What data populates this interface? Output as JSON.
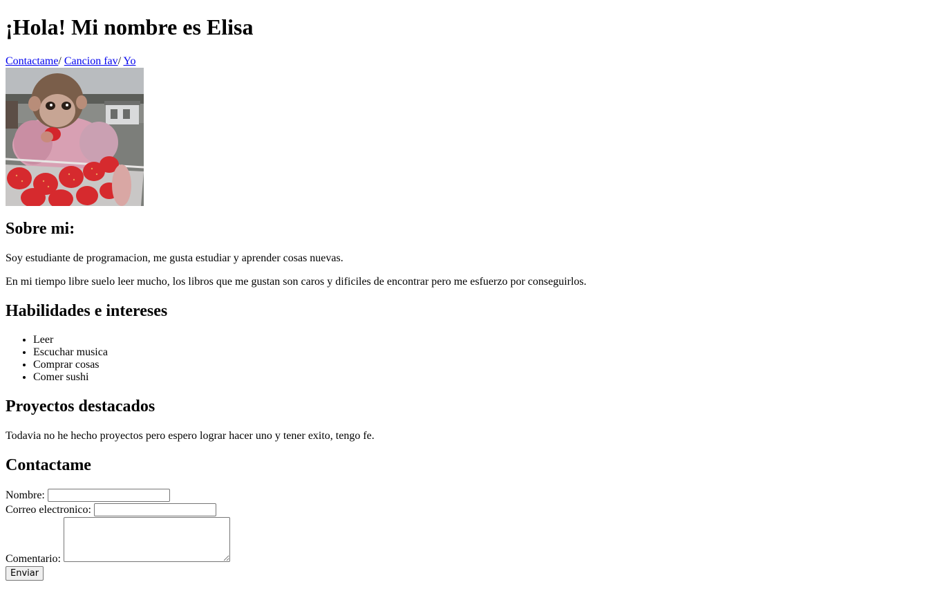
{
  "header": {
    "title": "¡Hola! Mi nombre es Elisa"
  },
  "nav": {
    "links": [
      {
        "label": "Contactame",
        "separator": "/ "
      },
      {
        "label": "Cancion fav",
        "separator": "/ "
      },
      {
        "label": "Yo",
        "separator": ""
      }
    ]
  },
  "about": {
    "heading": "Sobre mi:",
    "paragraphs": [
      "Soy estudiante de programacion, me gusta estudiar y aprender cosas nuevas.",
      "En mi tiempo libre suelo leer mucho, los libros que me gustan son caros y dificiles de encontrar pero me esfuerzo por conseguirlos."
    ]
  },
  "skills": {
    "heading": "Habilidades e intereses",
    "items": [
      "Leer",
      "Escuchar musica",
      "Comprar cosas",
      "Comer sushi"
    ]
  },
  "projects": {
    "heading": "Proyectos destacados",
    "text": "Todavia no he hecho proyectos pero espero lograr hacer uno y tener exito, tengo fe."
  },
  "contact": {
    "heading": "Contactame",
    "name_label": "Nombre:",
    "name_value": "",
    "email_label": "Correo electronico:",
    "email_value": "",
    "comment_label": "Comentario:",
    "comment_value": "",
    "submit_label": "Enviar"
  },
  "colors": {
    "link": "#0000ee",
    "text": "#000000",
    "background": "#ffffff"
  }
}
